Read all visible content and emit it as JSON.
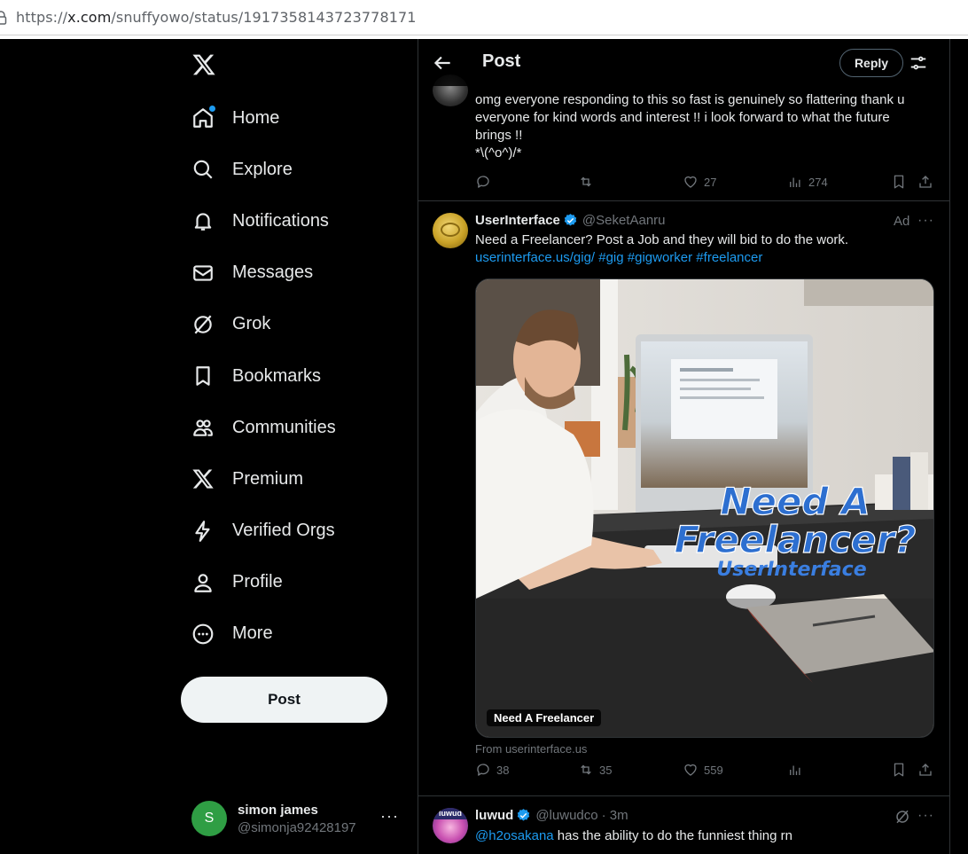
{
  "browser": {
    "url_prefix": "https://",
    "url_host": "x.com",
    "url_path": "/snuffyowo/status/1917358143723778171"
  },
  "nav": {
    "items": [
      {
        "label": "Home",
        "icon": "home-icon"
      },
      {
        "label": "Explore",
        "icon": "search-icon"
      },
      {
        "label": "Notifications",
        "icon": "bell-icon"
      },
      {
        "label": "Messages",
        "icon": "envelope-icon"
      },
      {
        "label": "Grok",
        "icon": "grok-icon"
      },
      {
        "label": "Bookmarks",
        "icon": "bookmark-icon"
      },
      {
        "label": "Communities",
        "icon": "people-icon"
      },
      {
        "label": "Premium",
        "icon": "x-logo-icon"
      },
      {
        "label": "Verified Orgs",
        "icon": "lightning-icon"
      },
      {
        "label": "Profile",
        "icon": "person-icon"
      },
      {
        "label": "More",
        "icon": "more-circle-icon"
      }
    ],
    "post_button": "Post"
  },
  "account": {
    "initial": "S",
    "name": "simon james",
    "handle": "@simonja92428197",
    "more": "···"
  },
  "header": {
    "title": "Post",
    "reply_button": "Reply"
  },
  "tweet_top": {
    "line1": "omg everyone responding to this so fast is genuinely so flattering thank u",
    "line2": "everyone for kind words and interest !! i look forward to what the future",
    "line3": "brings !!",
    "line4": "*\\(^o^)/*",
    "replies": "",
    "reposts": "",
    "likes": "27",
    "views": "274"
  },
  "ad_tweet": {
    "name": "UserInterface",
    "handle": "@SeketAanru",
    "ad_label": "Ad",
    "text": "Need a Freelancer? Post a Job and they will bid to do the work.",
    "link": "userinterface.us/gig/",
    "hashtags": "#gig #gigworker #freelancer",
    "media_headline_1": "Need A",
    "media_headline_2": "Freelancer?",
    "media_brand": "UserInterface",
    "media_label": "Need A Freelancer",
    "from": "From userinterface.us",
    "replies": "38",
    "reposts": "35",
    "likes": "559"
  },
  "tweet_last": {
    "avatar_caption": "luwud",
    "name": "luwud",
    "handle": "@luwudco",
    "time": "· 3m",
    "mention": "@h2osakana",
    "text": " has the ability to do the funniest thing rn"
  },
  "colors": {
    "accent": "#1d9bf0",
    "background": "#000000",
    "text": "#e7e9ea",
    "muted": "#71767b"
  }
}
